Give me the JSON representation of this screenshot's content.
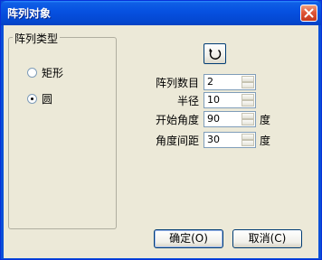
{
  "window": {
    "title": "阵列对象"
  },
  "group": {
    "legend": "阵列类型",
    "options": [
      {
        "label": "矩形",
        "checked": false
      },
      {
        "label": "圆",
        "checked": true
      }
    ]
  },
  "fields": {
    "count": {
      "label": "阵列数目",
      "value": "2"
    },
    "radius": {
      "label": "半径",
      "value": "10"
    },
    "start_angle": {
      "label": "开始角度",
      "value": "90",
      "unit": "度"
    },
    "angle_step": {
      "label": "角度间距",
      "value": "30",
      "unit": "度"
    }
  },
  "buttons": {
    "ok": "确定(O)",
    "cancel": "取消(C)"
  },
  "icons": {
    "close": "close-icon",
    "rotate": "rotate-direction-icon"
  },
  "colors": {
    "titlebar": "#0650e0",
    "close": "#e0573a",
    "client": "#ece9d8"
  }
}
